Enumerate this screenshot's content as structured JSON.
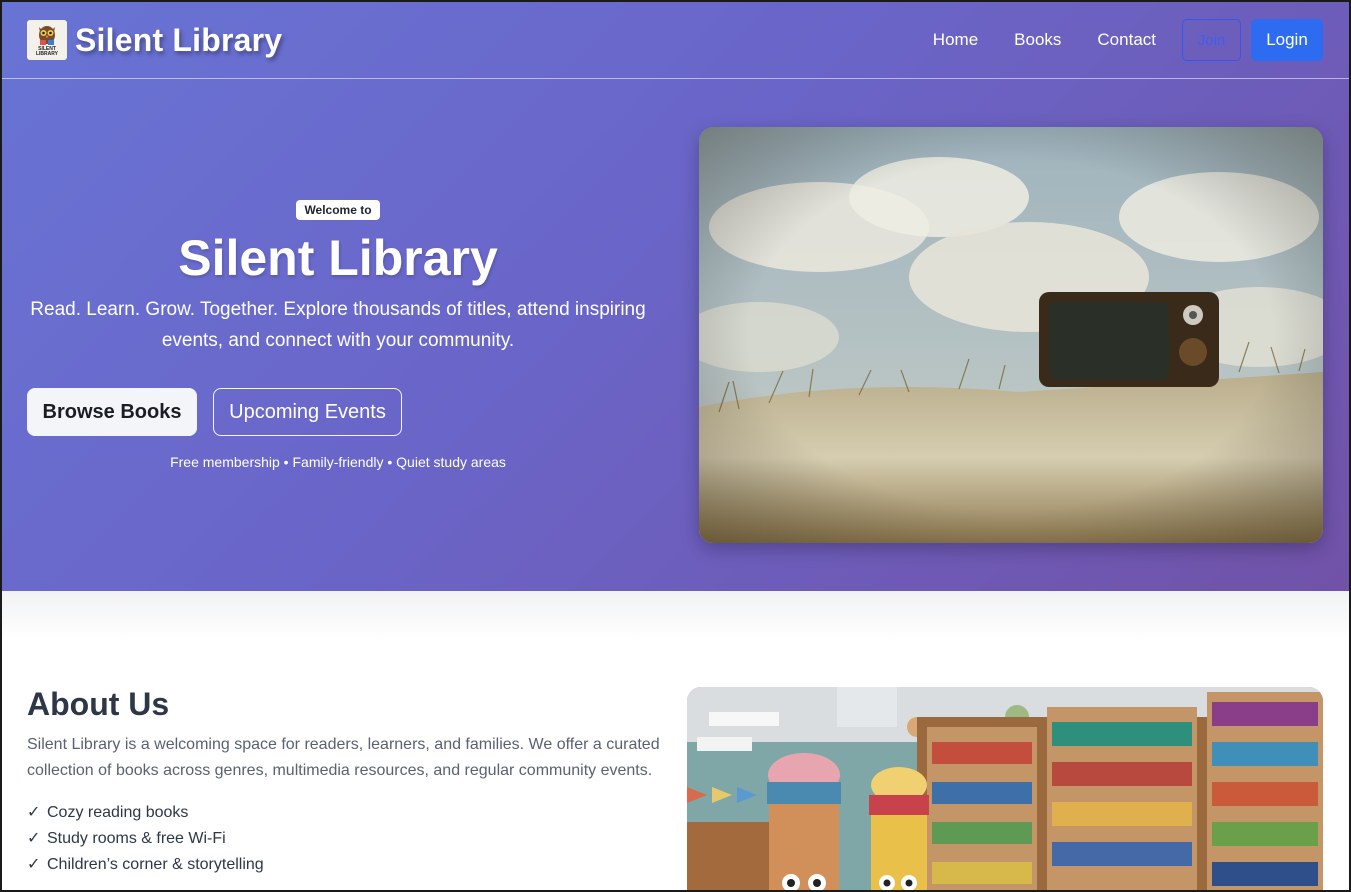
{
  "header": {
    "brand": "Silent Library",
    "logo_text": "SILENT LIBRARY",
    "nav": [
      "Home",
      "Books",
      "Contact"
    ],
    "join_label": "Join",
    "login_label": "Login"
  },
  "hero": {
    "badge": "Welcome to",
    "title": "Silent Library",
    "subtitle": "Read. Learn. Grow. Together. Explore thousands of titles, attend inspiring events, and connect with your community.",
    "primary_cta": "Browse Books",
    "secondary_cta": "Upcoming Events",
    "tagline": "Free membership • Family-friendly • Quiet study areas"
  },
  "about": {
    "title": "About Us",
    "text": "Silent Library is a welcoming space for readers, learners, and families. We offer a curated collection of books across genres, multimedia resources, and regular community events.",
    "features": [
      "Cozy reading books",
      "Study rooms & free Wi-Fi",
      "Children’s corner & storytelling"
    ]
  },
  "icons": {
    "check": "✓",
    "logo": "owl-icon"
  },
  "colors": {
    "hero_gradient_start": "#6874d4",
    "hero_gradient_end": "#7152a8",
    "login_button": "#2d6cf0",
    "join_button_text": "#3d5ef0",
    "heading_text": "#2d3748"
  }
}
